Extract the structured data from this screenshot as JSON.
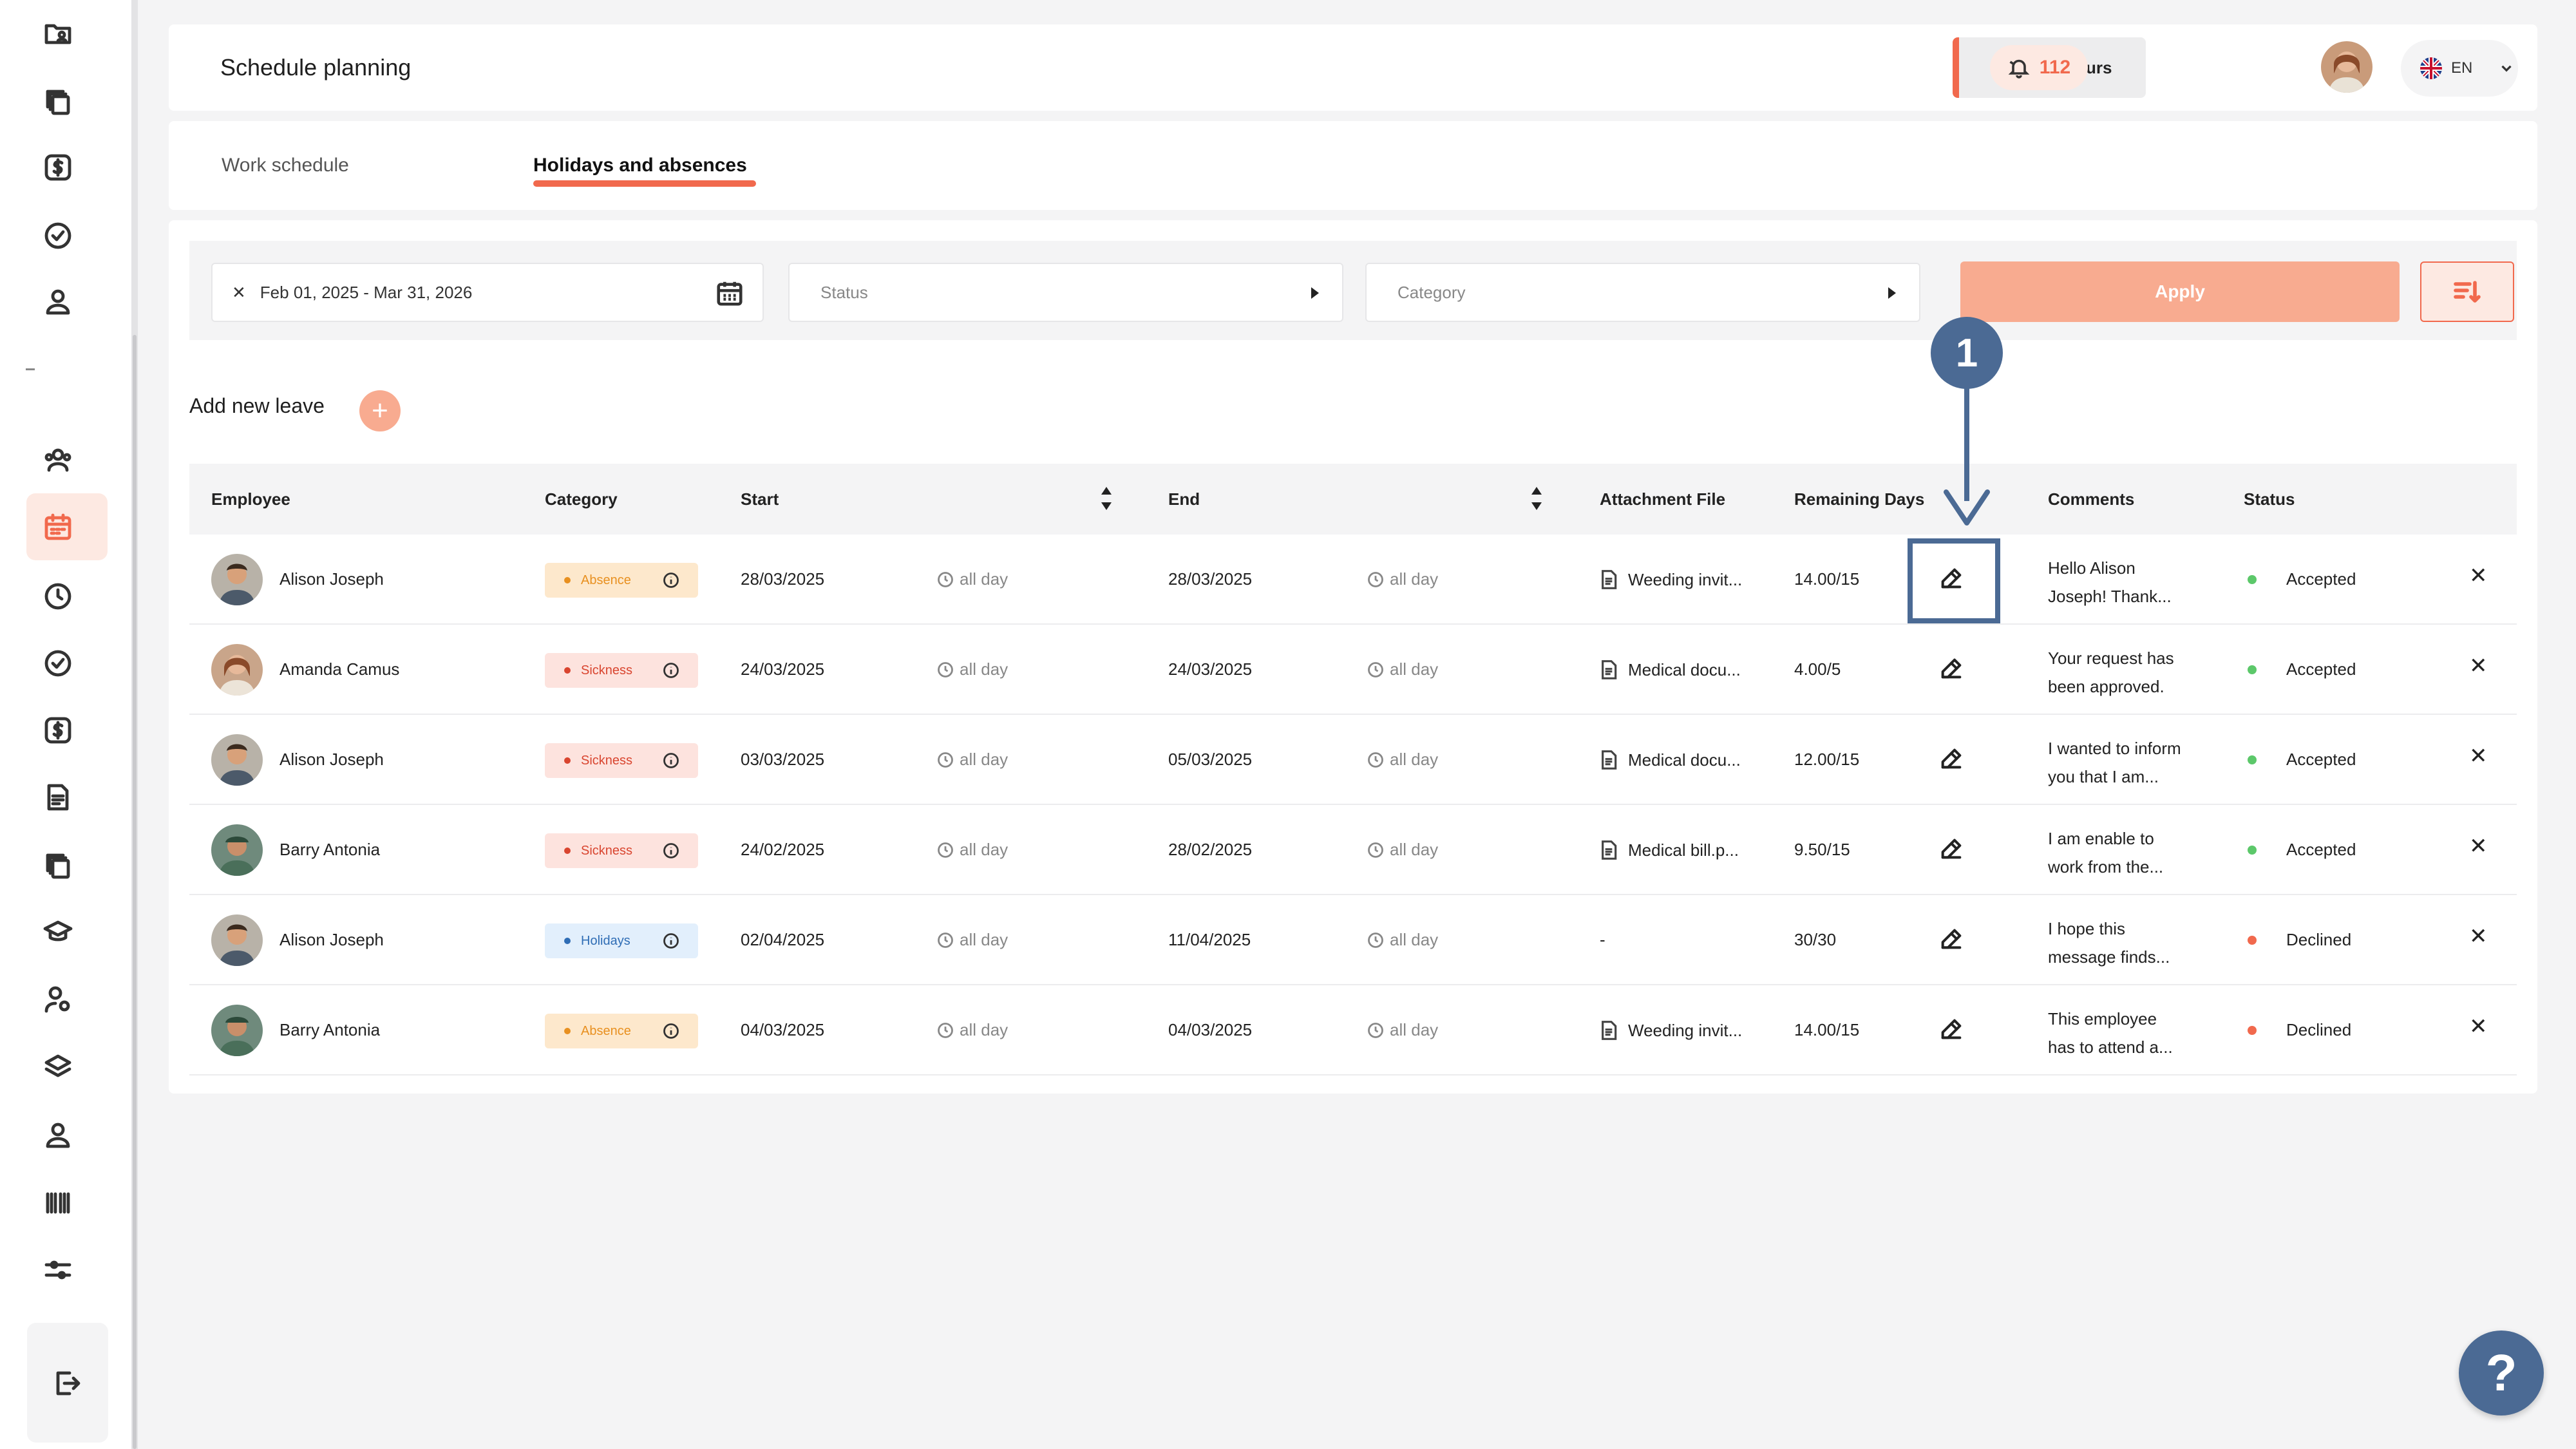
{
  "header": {
    "title": "Schedule planning",
    "save_label": "Save my hours",
    "notification_count": "112",
    "language": "EN"
  },
  "tabs": [
    {
      "label": "Work schedule",
      "active": false
    },
    {
      "label": "Holidays and absences",
      "active": true
    }
  ],
  "filters": {
    "date_range": "Feb 01, 2025 - Mar 31, 2026",
    "status_placeholder": "Status",
    "category_placeholder": "Category",
    "apply_label": "Apply"
  },
  "add_leave_label": "Add new leave",
  "table": {
    "headers": {
      "employee": "Employee",
      "category": "Category",
      "start": "Start",
      "end": "End",
      "attachment": "Attachment File",
      "remaining": "Remaining Days",
      "comments": "Comments",
      "status": "Status"
    },
    "rows": [
      {
        "employee": "Alison Joseph",
        "category": "Absence",
        "start": "28/03/2025",
        "start_time": "all day",
        "end": "28/03/2025",
        "end_time": "all day",
        "attachment": "Weeding invit...",
        "remaining": "14.00/15",
        "comment_l1": "Hello Alison",
        "comment_l2": "Joseph! Thank...",
        "status": "Accepted"
      },
      {
        "employee": "Amanda Camus",
        "category": "Sickness",
        "start": "24/03/2025",
        "start_time": "all day",
        "end": "24/03/2025",
        "end_time": "all day",
        "attachment": "Medical docu...",
        "remaining": "4.00/5",
        "comment_l1": "Your request has",
        "comment_l2": "been approved.",
        "status": "Accepted"
      },
      {
        "employee": "Alison Joseph",
        "category": "Sickness",
        "start": "03/03/2025",
        "start_time": "all day",
        "end": "05/03/2025",
        "end_time": "all day",
        "attachment": "Medical docu...",
        "remaining": "12.00/15",
        "comment_l1": "I wanted to inform",
        "comment_l2": "you that I am...",
        "status": "Accepted"
      },
      {
        "employee": "Barry Antonia",
        "category": "Sickness",
        "start": "24/02/2025",
        "start_time": "all day",
        "end": "28/02/2025",
        "end_time": "all day",
        "attachment": "Medical bill.p...",
        "remaining": "9.50/15",
        "comment_l1": "I am enable to",
        "comment_l2": "work from the...",
        "status": "Accepted"
      },
      {
        "employee": "Alison Joseph",
        "category": "Holidays",
        "start": "02/04/2025",
        "start_time": "all day",
        "end": "11/04/2025",
        "end_time": "all day",
        "attachment": "-",
        "remaining": "30/30",
        "comment_l1": "I hope this",
        "comment_l2": "message finds...",
        "status": "Declined"
      },
      {
        "employee": "Barry Antonia",
        "category": "Absence",
        "start": "04/03/2025",
        "start_time": "all day",
        "end": "04/03/2025",
        "end_time": "all day",
        "attachment": "Weeding invit...",
        "remaining": "14.00/15",
        "comment_l1": "This employee",
        "comment_l2": "has to attend a...",
        "status": "Declined"
      }
    ]
  },
  "annotation": {
    "step": "1"
  },
  "help_label": "?",
  "colors": {
    "accent": "#f1694d",
    "accent_light": "#f8ab90",
    "annotation": "#4b6a94",
    "accepted": "#5cc86a",
    "declined": "#f1694d",
    "absence_bg": "#fde8cc",
    "absence_fg": "#e89020",
    "sickness_bg": "#fde3de",
    "sickness_fg": "#d9452f",
    "holidays_bg": "#e2effc",
    "holidays_fg": "#2f6db5"
  },
  "icons": [
    "folder-user-icon",
    "copy-icon",
    "dollar-icon",
    "check-circle-icon",
    "user-icon",
    "users-icon",
    "calendar-icon",
    "clock-icon",
    "check-circle-icon",
    "dollar-icon",
    "report-icon",
    "copy-icon",
    "graduation-icon",
    "user-settings-icon",
    "layers-icon",
    "user-icon",
    "barcode-icon",
    "sliders-icon",
    "logout-icon"
  ]
}
